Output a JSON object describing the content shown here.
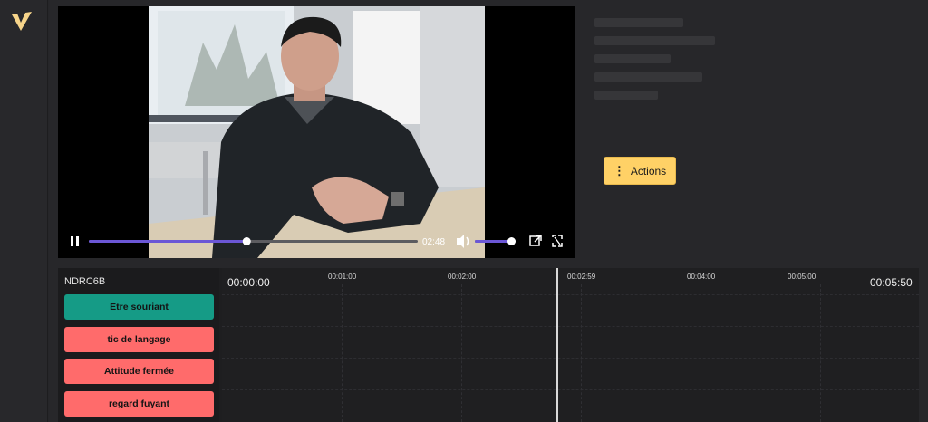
{
  "sidebar": {
    "logo_icon": "app-logo-icon"
  },
  "player": {
    "current_time": "02:48",
    "progress": 0.48,
    "volume": 0.9,
    "icons": {
      "pause": "pause-icon",
      "volume": "volume-icon",
      "popout": "external-link-icon",
      "fullscreen": "fullscreen-icon"
    },
    "accent_color": "#6b57d6"
  },
  "actions": {
    "label": "Actions",
    "icon": "more-vertical-icon"
  },
  "timeline": {
    "session_code": "NDRC6B",
    "start_time": "00:00:00",
    "end_time": "00:05:50",
    "ticks": [
      "00:01:00",
      "00:02:00",
      "00:02:59",
      "00:04:00",
      "00:05:00"
    ],
    "tags": [
      {
        "label": "Etre souriant",
        "color": "#159b86"
      },
      {
        "label": "tic de langage",
        "color": "#ff6b6b"
      },
      {
        "label": "Attitude fermée",
        "color": "#ff6b6b"
      },
      {
        "label": "regard fuyant",
        "color": "#ff6b6b"
      }
    ]
  }
}
